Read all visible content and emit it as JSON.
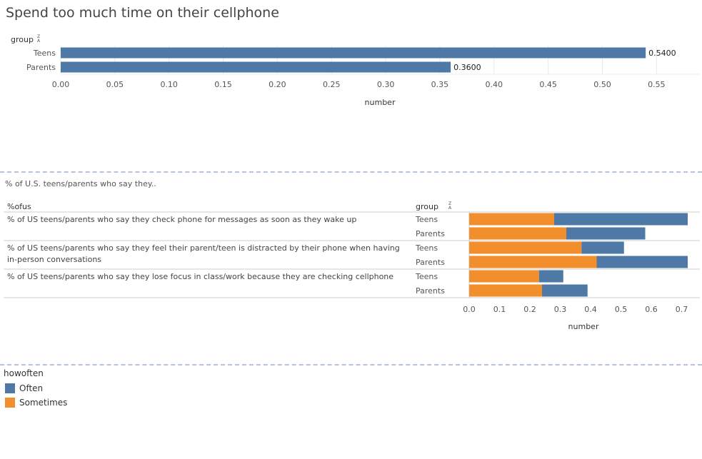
{
  "dashboard": {
    "title": "Spend too much time on their cellphone",
    "subtitle": "% of U.S. teens/parents who say they..",
    "colors": {
      "often": "#4e79a7",
      "sometimes": "#f28e2b",
      "grid": "#e9e9e9",
      "axis": "#cfcfcf"
    }
  },
  "chart_data": [
    {
      "type": "bar",
      "orientation": "horizontal",
      "row_field_label": "group",
      "sort_icon": "sort-alpha-icon",
      "categories": [
        "Teens",
        "Parents"
      ],
      "values": [
        0.54,
        0.36
      ],
      "data_labels": [
        "0.5400",
        "0.3600"
      ],
      "xlabel": "number",
      "xlim": [
        0,
        0.59
      ],
      "xticks": [
        0.0,
        0.05,
        0.1,
        0.15,
        0.2,
        0.25,
        0.3,
        0.35,
        0.4,
        0.45,
        0.5,
        0.55
      ],
      "xtick_labels": [
        "0.00",
        "0.05",
        "0.10",
        "0.15",
        "0.20",
        "0.25",
        "0.30",
        "0.35",
        "0.40",
        "0.45",
        "0.50",
        "0.55"
      ],
      "grid": true,
      "bar_color": "#4e79a7"
    },
    {
      "type": "bar",
      "orientation": "horizontal",
      "stacked": true,
      "outer_field_label": "%ofus",
      "row_field_label": "group",
      "sort_icon": "sort-alpha-icon",
      "groups": [
        {
          "label": "% of US teens/parents who say they check phone for messages as soon as they wake up",
          "lines": [
            "% of US teens/parents who say they check phone for messages as soon as they wake up"
          ],
          "rows": [
            {
              "group": "Teens",
              "sometimes": 0.28,
              "often": 0.44
            },
            {
              "group": "Parents",
              "sometimes": 0.32,
              "often": 0.26
            }
          ]
        },
        {
          "label": "% of US teens/parents who say they feel their parent/teen is distracted by their phone when having in-person conversations",
          "lines": [
            "% of US teens/parents who say they feel their parent/teen is distracted by their phone when having",
            "in-person conversations"
          ],
          "rows": [
            {
              "group": "Teens",
              "sometimes": 0.37,
              "often": 0.14
            },
            {
              "group": "Parents",
              "sometimes": 0.42,
              "often": 0.3
            }
          ]
        },
        {
          "label": "% of US teens/parents who say they lose focus in class/work because they are checking cellphone",
          "lines": [
            "% of US teens/parents who say they lose focus in class/work because they are checking cellphone"
          ],
          "rows": [
            {
              "group": "Teens",
              "sometimes": 0.23,
              "often": 0.08
            },
            {
              "group": "Parents",
              "sometimes": 0.24,
              "often": 0.15
            }
          ]
        }
      ],
      "xlabel": "number",
      "xlim": [
        0,
        0.76
      ],
      "xticks": [
        0.0,
        0.1,
        0.2,
        0.3,
        0.4,
        0.5,
        0.6,
        0.7
      ],
      "xtick_labels": [
        "0.0",
        "0.1",
        "0.2",
        "0.3",
        "0.4",
        "0.5",
        "0.6",
        "0.7"
      ],
      "grid": false,
      "legend": {
        "title": "howoften",
        "position": "bottom-left",
        "items": [
          {
            "key": "often",
            "label": "Often",
            "color": "#4e79a7"
          },
          {
            "key": "sometimes",
            "label": "Sometimes",
            "color": "#f28e2b"
          }
        ]
      }
    }
  ]
}
